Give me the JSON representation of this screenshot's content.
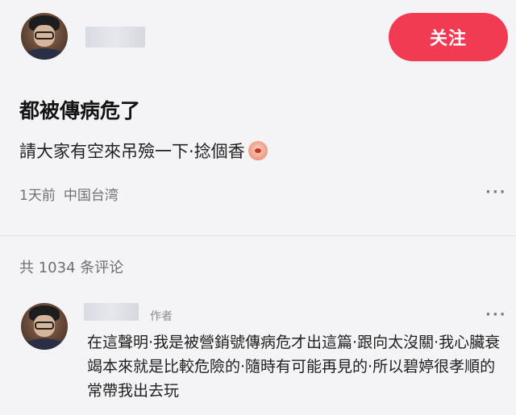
{
  "header": {
    "follow_label": "关注"
  },
  "post": {
    "title": "都被傳病危了",
    "body": "請大家有空來吊殮一下·捻個香",
    "emoji_icon": "face-emoji-icon",
    "time": "1天前",
    "location": "中国台湾",
    "more_label": "···"
  },
  "comments": {
    "count_label": "共 1034 条评论",
    "items": [
      {
        "author_tag": "作者",
        "text": "在這聲明·我是被營銷號傳病危才出這篇·跟向太沒關·我心臟衰竭本來就是比較危險的·隨時有可能再見的·所以碧婷很孝順的常帶我出去玩",
        "more_label": "···"
      }
    ]
  },
  "colors": {
    "accent": "#f03b52",
    "background": "#f4f4f7"
  }
}
